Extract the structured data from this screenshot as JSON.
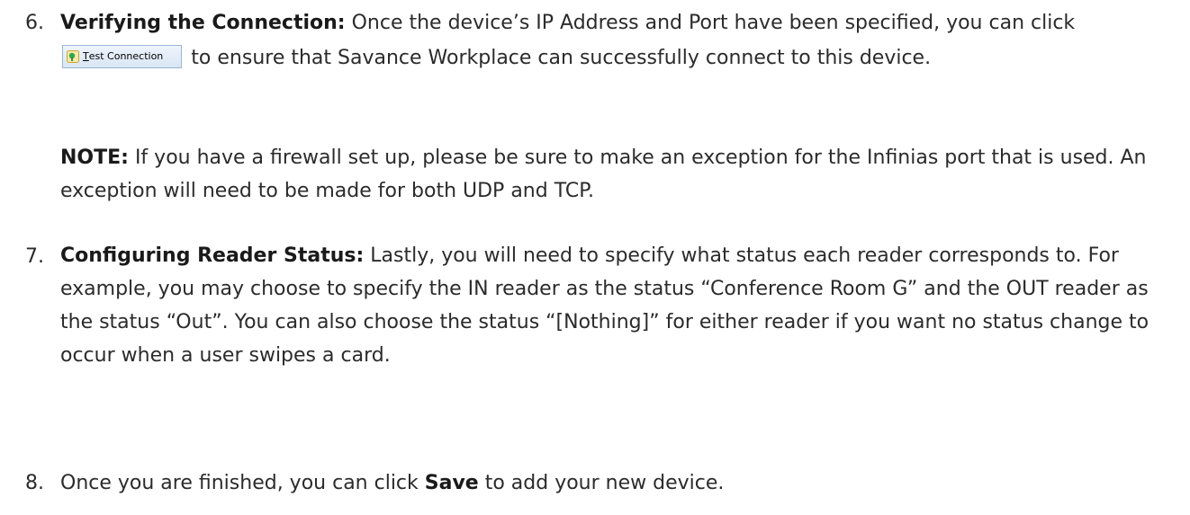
{
  "step6": {
    "number": "6.",
    "heading": "Verifying the Connection:",
    "text_a": " Once the device’s IP Address and Port have been specified, you can click ",
    "button": {
      "icon": "connection-status-icon",
      "accel": "T",
      "rest": "est Connection"
    },
    "text_b": "to ensure that Savance Workplace can successfully connect to this device."
  },
  "note": {
    "label": "NOTE:",
    "text": " If you have a firewall set up, please be sure to make an exception for the Infinias port that is used. An exception will need to be made for both UDP and TCP."
  },
  "step7": {
    "number": "7.",
    "heading": "Configuring Reader Status:",
    "text": " Lastly, you will need to specify what status each reader corresponds to. For example, you may choose to specify the IN reader as the status “Conference Room G” and the OUT reader as the status “Out”. You can also choose the status “[Nothing]” for either reader if you want no status change to occur when a user swipes a card."
  },
  "step8": {
    "number": "8.",
    "text_a": "Once you are finished, you can click ",
    "bold": "Save",
    "text_b": " to add your new device."
  }
}
